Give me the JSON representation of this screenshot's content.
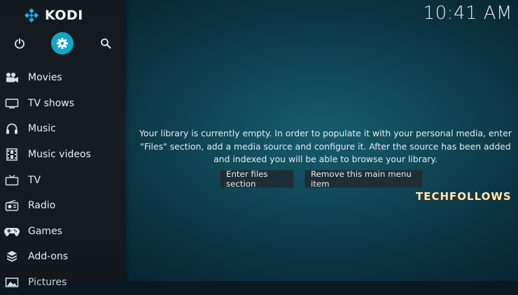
{
  "app": {
    "name": "KODI"
  },
  "header": {
    "time": "10:41 AM"
  },
  "top_icons": [
    "power-icon",
    "settings-icon",
    "search-icon"
  ],
  "sidebar": {
    "items": [
      {
        "label": "Movies",
        "icon": "movie-camera-icon"
      },
      {
        "label": "TV shows",
        "icon": "tv-icon"
      },
      {
        "label": "Music",
        "icon": "headphones-icon"
      },
      {
        "label": "Music videos",
        "icon": "film-strip-icon"
      },
      {
        "label": "TV",
        "icon": "tv-antenna-icon"
      },
      {
        "label": "Radio",
        "icon": "radio-icon"
      },
      {
        "label": "Games",
        "icon": "gamepad-icon"
      },
      {
        "label": "Add-ons",
        "icon": "addons-icon"
      },
      {
        "label": "Pictures",
        "icon": "picture-icon"
      }
    ]
  },
  "main": {
    "message": "Your library is currently empty. In order to populate it with your personal media, enter \"Files\" section, add a media source and configure it. After the source has been added and indexed you will be able to browse your library.",
    "buttons": {
      "enter_files": "Enter files section",
      "remove_item": "Remove this main menu item"
    }
  },
  "watermark": "TECHFOLLOWS",
  "colors": {
    "accent": "#12a6c8",
    "sidebar_bg": "#161d22",
    "main_bg": "#114958",
    "logo_blue": "#17b2e7"
  }
}
